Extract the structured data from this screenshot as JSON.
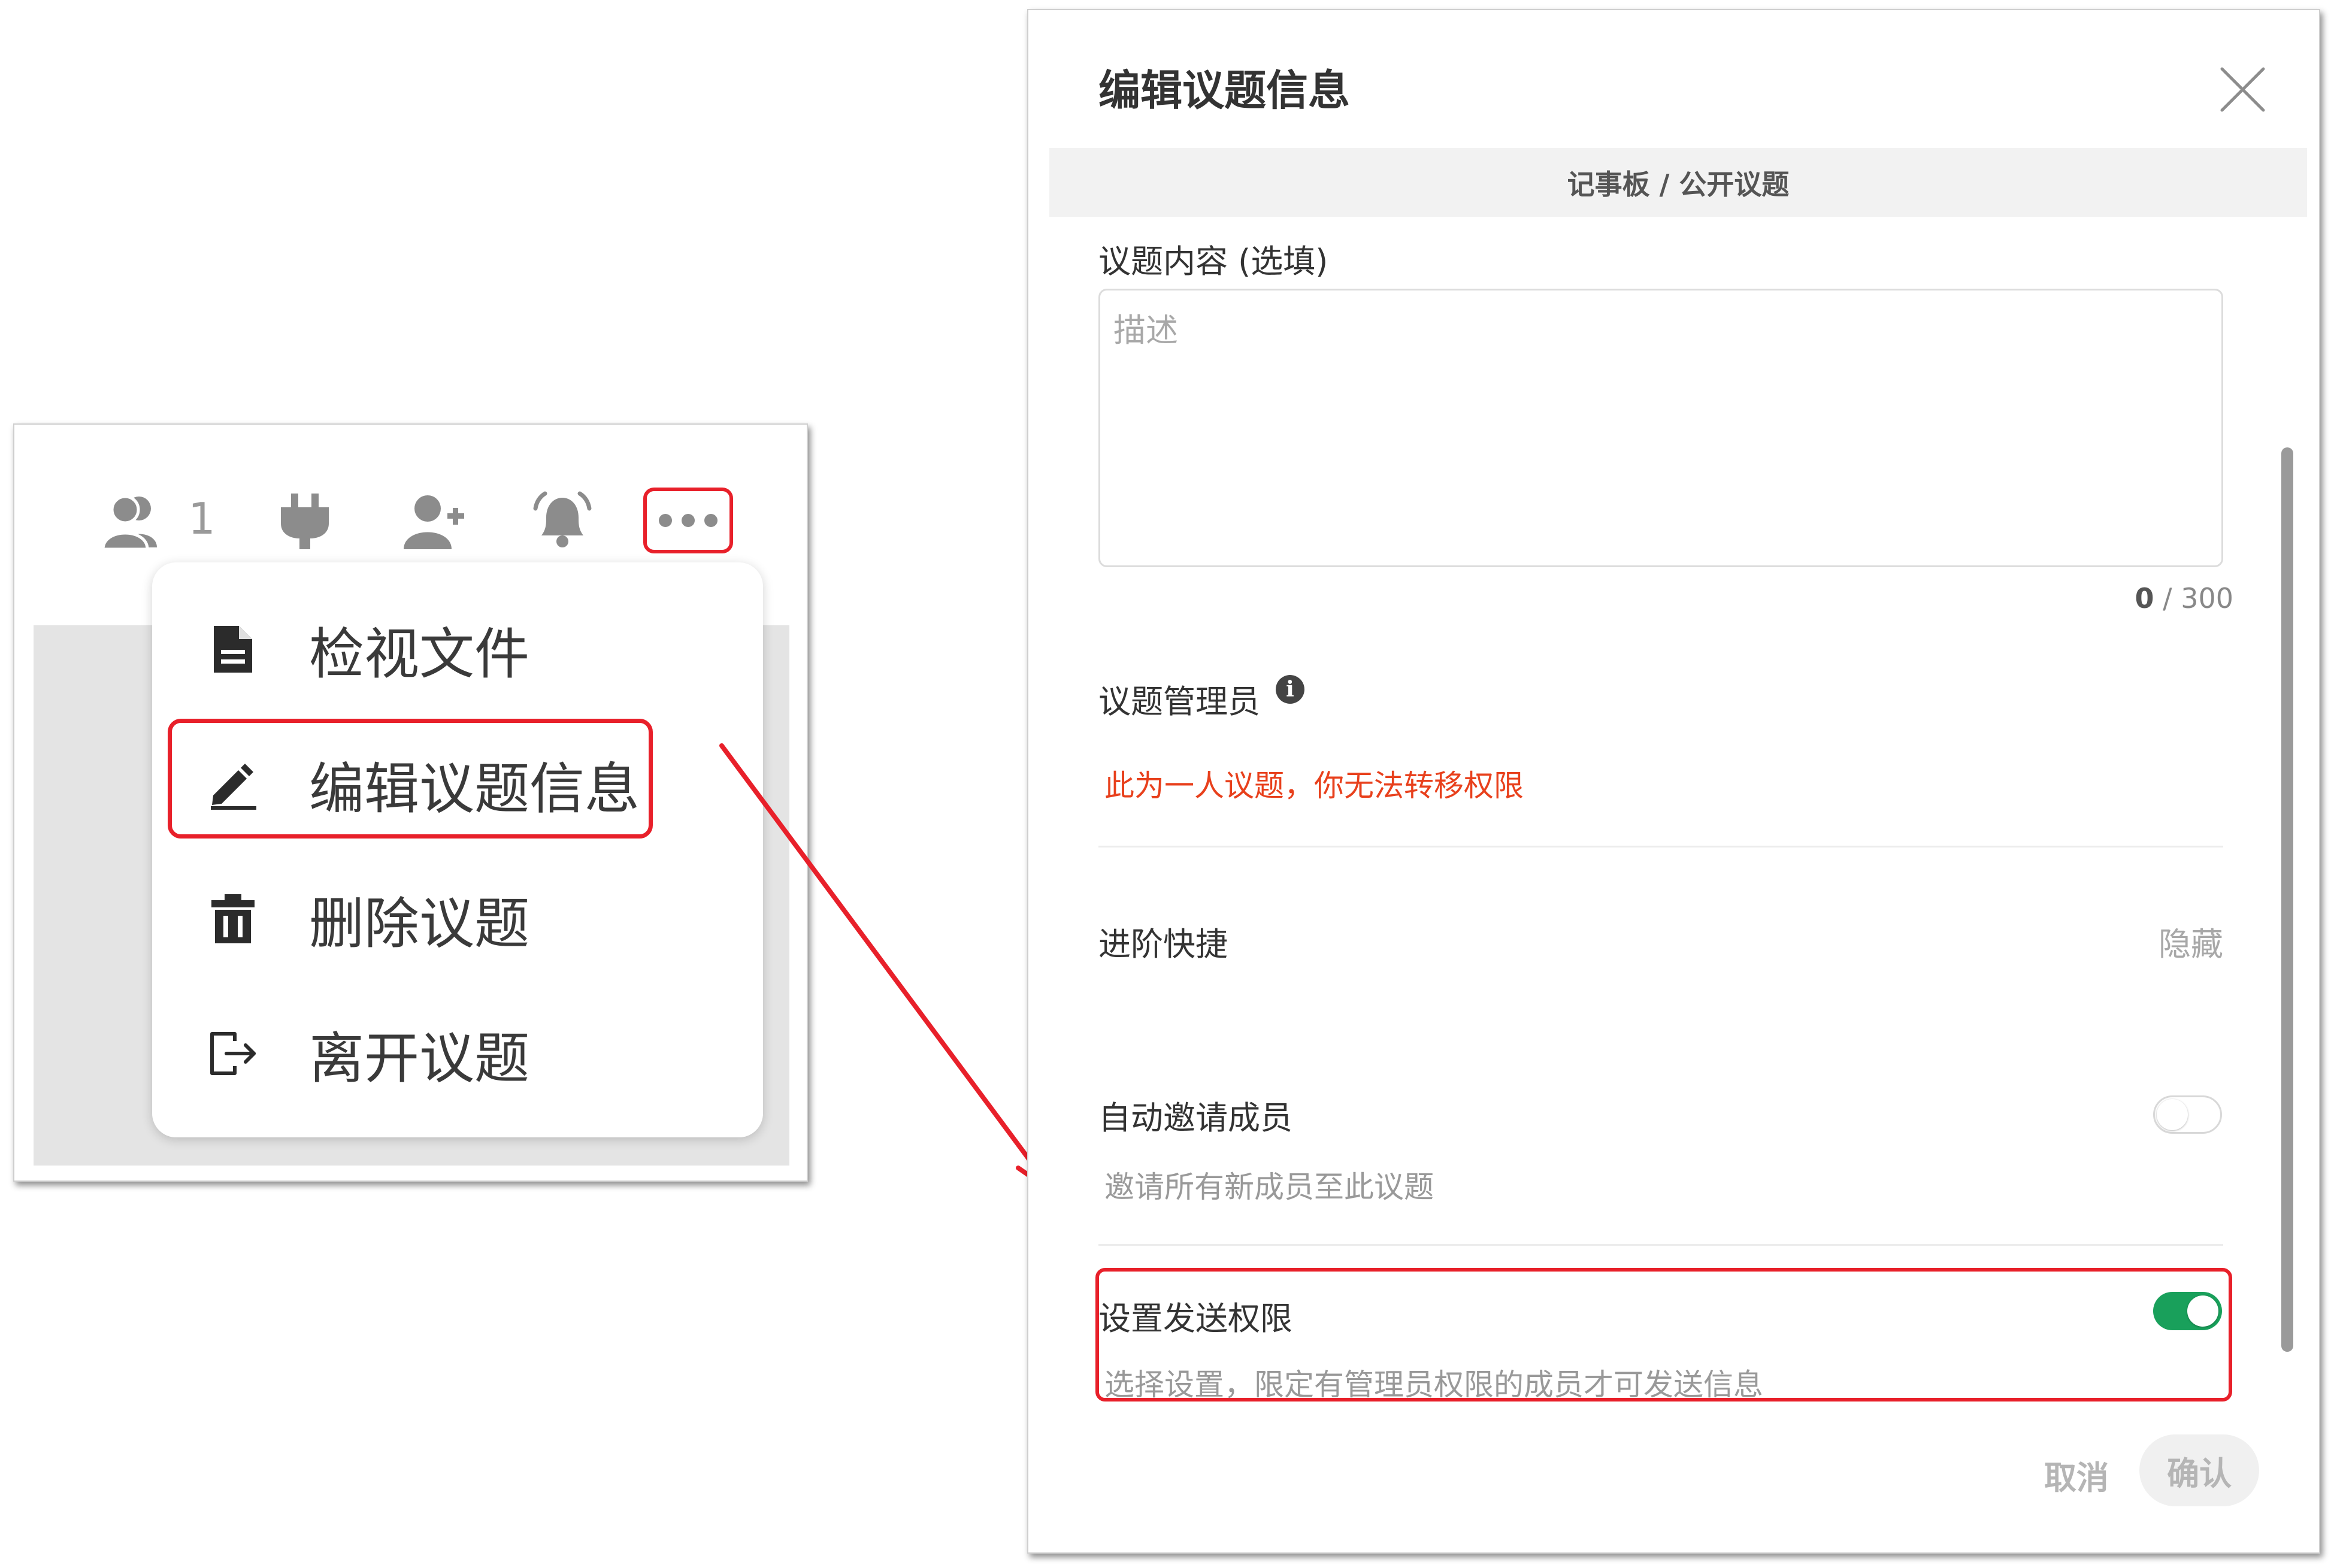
{
  "toolbar": {
    "member_count": "1",
    "icons": [
      "members-icon",
      "plug-icon",
      "add-member-icon",
      "bell-icon",
      "more-icon"
    ]
  },
  "menu": {
    "items": [
      {
        "label": "检视文件",
        "icon": "file-icon"
      },
      {
        "label": "编辑议题信息",
        "icon": "pencil-icon"
      },
      {
        "label": "删除议题",
        "icon": "trash-icon"
      },
      {
        "label": "离开议题",
        "icon": "exit-icon"
      }
    ]
  },
  "dialog": {
    "title": "编辑议题信息",
    "breadcrumb": "记事板 / 公开议题",
    "content_label": "议题内容 (选填)",
    "content_placeholder": "描述",
    "char_count_current": "0",
    "char_count_max": "/ 300",
    "admin_label": "议题管理员",
    "admin_warning": "此为一人议题，你无法转移权限",
    "advanced_label": "进阶快捷",
    "advanced_toggle": "隐藏",
    "auto_invite_label": "自动邀请成员",
    "auto_invite_desc": "邀请所有新成员至此议题",
    "auto_invite_on": false,
    "send_perm_label": "设置发送权限",
    "send_perm_desc": "选择设置，限定有管理员权限的成员才可发送信息",
    "send_perm_on": true,
    "cancel_label": "取消",
    "confirm_label": "确认"
  },
  "colors": {
    "highlight": "#e8202a",
    "warning_text": "#e8401c",
    "switch_on": "#19a05b",
    "icon_gray": "#8c8c8c"
  }
}
